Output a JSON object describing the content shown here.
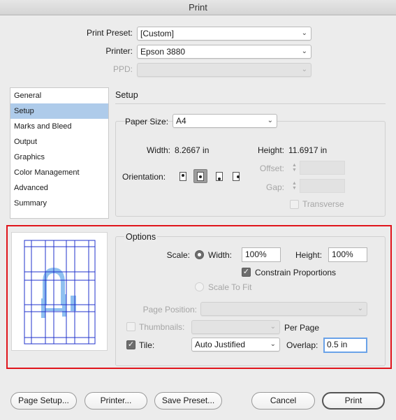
{
  "window": {
    "title": "Print"
  },
  "top": {
    "preset_label": "Print Preset:",
    "preset_value": "[Custom]",
    "printer_label": "Printer:",
    "printer_value": "Epson 3880",
    "ppd_label": "PPD:",
    "ppd_value": ""
  },
  "sidebar": {
    "items": [
      {
        "label": "General"
      },
      {
        "label": "Setup"
      },
      {
        "label": "Marks and Bleed"
      },
      {
        "label": "Output"
      },
      {
        "label": "Graphics"
      },
      {
        "label": "Color Management"
      },
      {
        "label": "Advanced"
      },
      {
        "label": "Summary"
      }
    ],
    "selected": "Setup"
  },
  "setup": {
    "header": "Setup",
    "paper_size_label": "Paper Size:",
    "paper_size_value": "A4",
    "width_label": "Width:",
    "width_value": "8.2667 in",
    "height_label": "Height:",
    "height_value": "11.6917 in",
    "orientation_label": "Orientation:",
    "orientation_selected": "reverse-portrait",
    "offset_label": "Offset:",
    "gap_label": "Gap:",
    "transverse_label": "Transverse"
  },
  "options": {
    "header": "Options",
    "scale_label": "Scale:",
    "width_label": "Width:",
    "width_value": "100%",
    "height_label": "Height:",
    "height_value": "100%",
    "constrain_label": "Constrain Proportions",
    "constrain_checked": true,
    "scale_to_fit_label": "Scale To Fit",
    "page_position_label": "Page Position:",
    "page_position_value": "",
    "thumbnails_label": "Thumbnails:",
    "thumbnails_value": "",
    "per_page_label": "Per Page",
    "tile_label": "Tile:",
    "tile_checked": true,
    "tile_value": "Auto Justified",
    "overlap_label": "Overlap:",
    "overlap_value": "0.5 in"
  },
  "buttons": {
    "page_setup": "Page Setup...",
    "printer": "Printer...",
    "save_preset": "Save Preset...",
    "cancel": "Cancel",
    "print": "Print"
  },
  "colors": {
    "highlight_box": "#e0151c",
    "preview_tile_lines": "#2233cc",
    "preview_glyph": "#8fc0f0",
    "sidebar_selected": "#aecbea"
  }
}
